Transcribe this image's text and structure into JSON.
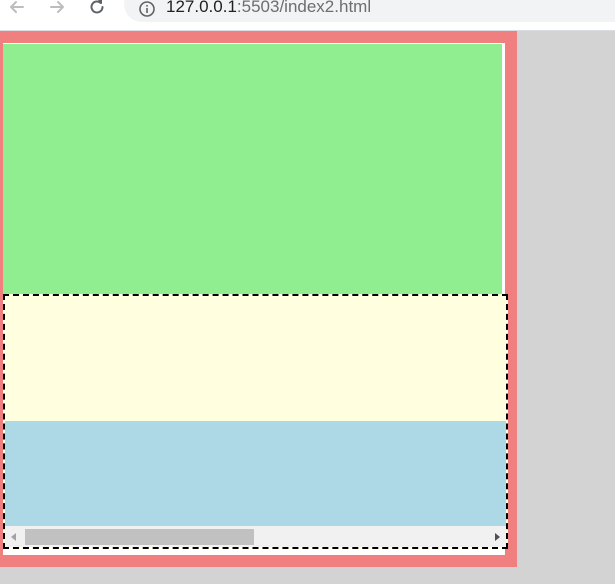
{
  "browser": {
    "url_host": "127.0.0.1",
    "url_rest": ":5503/index2.html",
    "back_icon": "arrow-left-icon",
    "forward_icon": "arrow-right-icon",
    "reload_icon": "reload-icon",
    "site_info_icon": "info-icon"
  },
  "page": {
    "colors": {
      "outer_border": "#f08080",
      "green_block": "#90ee90",
      "yellow_block": "#ffffe0",
      "blue_block": "#add8e6",
      "background": "#d3d3d3"
    }
  }
}
